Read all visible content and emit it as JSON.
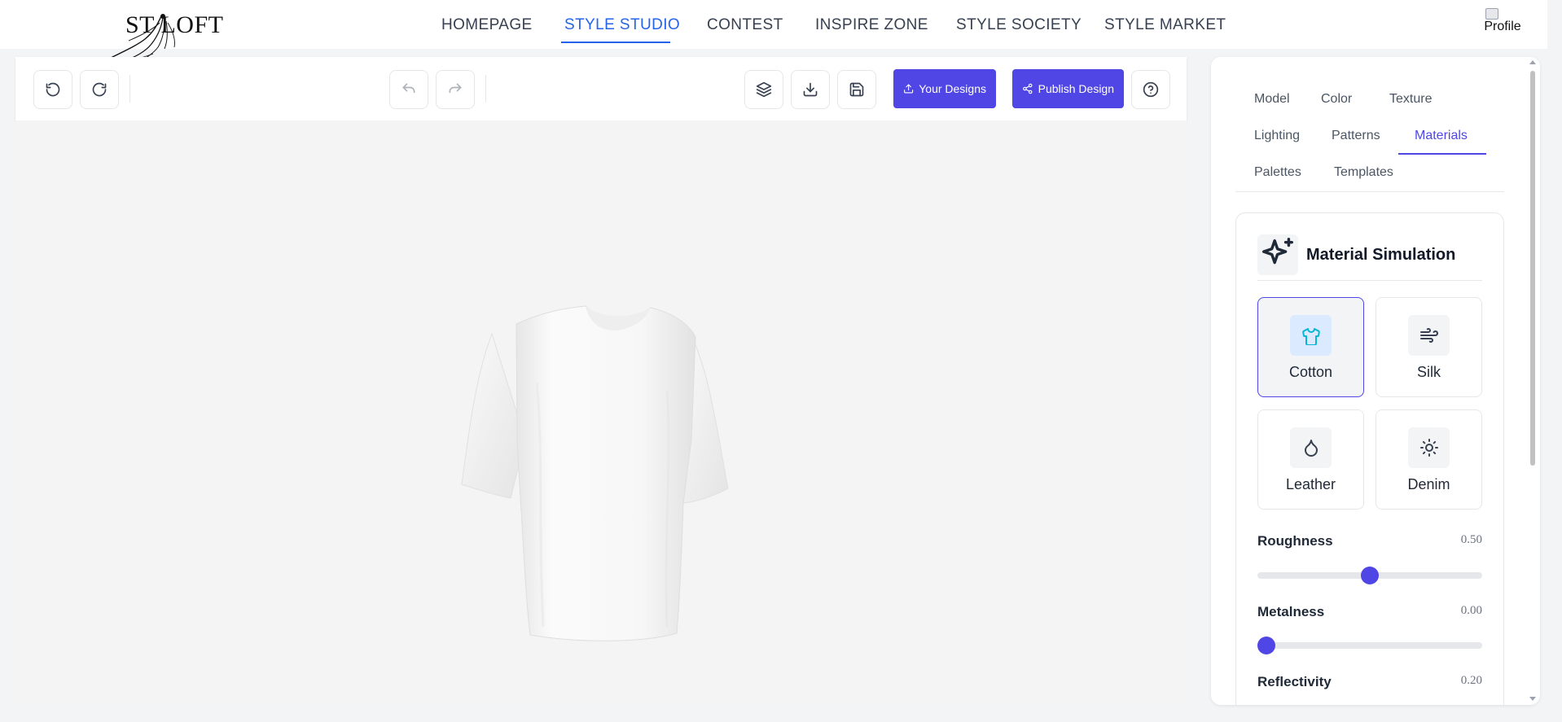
{
  "brand": {
    "logo_text": "ST LOFT"
  },
  "nav": {
    "items": [
      {
        "label": "HOMEPAGE"
      },
      {
        "label": "STYLE STUDIO"
      },
      {
        "label": "CONTEST"
      },
      {
        "label": "INSPIRE ZONE"
      },
      {
        "label": "STYLE SOCIETY"
      },
      {
        "label": "STYLE MARKET"
      }
    ],
    "active": "STYLE STUDIO",
    "profile_alt": "Profile"
  },
  "toolbar": {
    "icons": [
      "rotate-left-icon",
      "rotate-right-icon",
      "undo-icon",
      "redo-icon",
      "layers-icon",
      "download-icon",
      "save-icon",
      "help-icon"
    ],
    "your_designs_label": "Your Designs",
    "publish_label": "Publish Design"
  },
  "panel": {
    "tabs": [
      {
        "label": "Model"
      },
      {
        "label": "Color"
      },
      {
        "label": "Texture"
      },
      {
        "label": "Lighting"
      },
      {
        "label": "Patterns"
      },
      {
        "label": "Materials"
      },
      {
        "label": "Palettes"
      },
      {
        "label": "Templates"
      }
    ],
    "active_tab": "Materials",
    "section": {
      "title": "Material Simulation",
      "icon": "sparkles-icon",
      "materials": [
        {
          "label": "Cotton",
          "icon": "shirt-icon",
          "selected": true
        },
        {
          "label": "Silk",
          "icon": "wind-icon",
          "selected": false
        },
        {
          "label": "Leather",
          "icon": "droplet-icon",
          "selected": false
        },
        {
          "label": "Denim",
          "icon": "sun-icon",
          "selected": false
        }
      ],
      "sliders": [
        {
          "label": "Roughness",
          "value_text": "0.50",
          "value": 0.5
        },
        {
          "label": "Metalness",
          "value_text": "0.00",
          "value": 0.0
        },
        {
          "label": "Reflectivity",
          "value_text": "0.20",
          "value": 0.2
        }
      ]
    }
  },
  "colors": {
    "accent": "#4f46e5",
    "nav_active": "#2563eb"
  }
}
